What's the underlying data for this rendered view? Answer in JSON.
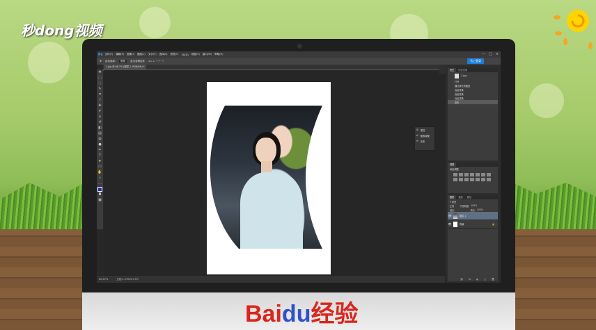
{
  "watermark": {
    "site_logo": "秒dong视频"
  },
  "footer": {
    "brand_text": "Bai",
    "brand_paw": "du",
    "brand_suffix": "经验"
  },
  "app": {
    "logo": "Ps",
    "menus": [
      "文件(F)",
      "编辑(E)",
      "图像(I)",
      "图层(L)",
      "文字(Y)",
      "选择(S)",
      "滤镜(T)",
      "3D(D)",
      "视图(V)",
      "窗口(W)",
      "帮助(H)"
    ],
    "window_controls": [
      "—",
      "□",
      "×"
    ],
    "login_label": "马上登录",
    "options": [
      "自动选择:",
      "图层",
      "显示变换控件"
    ],
    "document_tab": "1.jpg @ 66.7% (图层 1, RGB/8#) *",
    "status": {
      "zoom": "66.67%",
      "doc_size": "文档:1.29M/2.07M"
    }
  },
  "context_menu": {
    "items": [
      {
        "icon": "properties-icon",
        "label": "属性"
      },
      {
        "icon": "adjust-icon",
        "label": "图像调整"
      },
      {
        "icon": "history-icon",
        "label": "历史"
      }
    ]
  },
  "history_panel": {
    "tabs": [
      "历史",
      "历史记录"
    ],
    "snapshot": "1.jpg",
    "items": [
      "打开",
      "通过拷贝的图层",
      "自由变换",
      "自由变换",
      "自由变换",
      "变形"
    ]
  },
  "adjustments_panel": {
    "tabs": [
      "调整"
    ],
    "subtitle": "添加调整"
  },
  "layers_panel": {
    "tabs": [
      "图层",
      "通道",
      "路径"
    ],
    "kind": "P 类型",
    "blend_mode": "正常",
    "opacity_label": "不透明度:",
    "opacity": "100%",
    "lock_label": "锁定:",
    "fill_label": "填充:",
    "fill": "100%",
    "layers": [
      {
        "name": "图层 1",
        "selected": true
      },
      {
        "name": "背景",
        "selected": false
      }
    ]
  },
  "colors": {
    "accent": "#1e7ed6",
    "ps_blue": "#31a8ff",
    "brand_red": "#d9261c",
    "brand_blue": "#2e52c9"
  }
}
